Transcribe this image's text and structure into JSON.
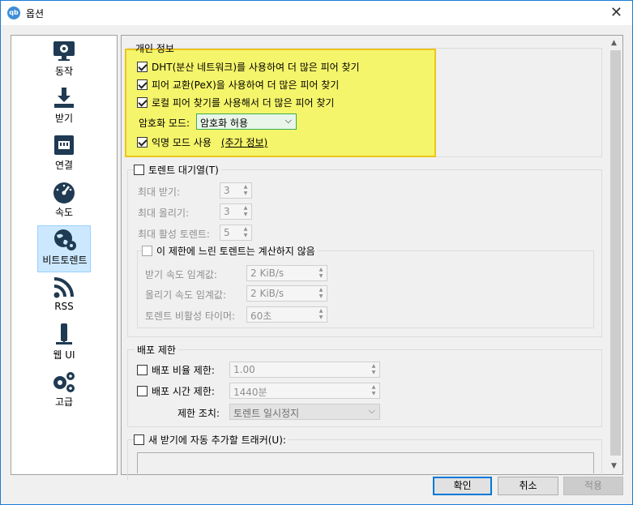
{
  "window": {
    "title": "옵션",
    "app_icon": "qb"
  },
  "sidebar": {
    "items": [
      {
        "label": "동작",
        "icon": "monitor-gear-icon"
      },
      {
        "label": "받기",
        "icon": "download-icon"
      },
      {
        "label": "연결",
        "icon": "network-port-icon"
      },
      {
        "label": "속도",
        "icon": "speedometer-icon"
      },
      {
        "label": "비트토렌트",
        "icon": "globe-gear-icon",
        "selected": true
      },
      {
        "label": "RSS",
        "icon": "rss-icon"
      },
      {
        "label": "웹 UI",
        "icon": "web-ui-icon"
      },
      {
        "label": "고급",
        "icon": "gears-icon"
      }
    ]
  },
  "privacy": {
    "title": "개인 정보",
    "dht": "DHT(분산 네트워크)를 사용하여 더 많은 피어 찾기",
    "pex": "피어 교환(PeX)을 사용하여 더 많은 피어 찾기",
    "lsd": "로컬 피어 찾기를 사용해서 더 많은 피어 찾기",
    "encryption_label": "암호화 모드:",
    "encryption_value": "암호화 허용",
    "anon_label": "익명 모드 사용",
    "anon_link": "(추가 정보)"
  },
  "queue": {
    "title": "토렌트 대기열(T)",
    "max_downloads_label": "최대 받기:",
    "max_downloads": "3",
    "max_uploads_label": "최대 올리기:",
    "max_uploads": "3",
    "max_active_label": "최대 활성 토렌트:",
    "max_active": "5",
    "slow_title": "이 제한에 느린 토렌트는 계산하지 않음",
    "dl_threshold_label": "받기 속도 임계값:",
    "dl_threshold": "2 KiB/s",
    "ul_threshold_label": "올리기 속도 임계값:",
    "ul_threshold": "2 KiB/s",
    "inactivity_label": "토렌트 비활성 타이머:",
    "inactivity": "60초"
  },
  "seeding": {
    "title": "배포 제한",
    "ratio_label": "배포 비율 제한:",
    "ratio": "1.00",
    "time_label": "배포 시간 제한:",
    "time": "1440분",
    "action_label": "제한 조치:",
    "action": "토렌트 일시정지"
  },
  "trackers": {
    "title": "새 받기에 자동 추가할 트래커(U):"
  },
  "buttons": {
    "ok": "확인",
    "cancel": "취소",
    "apply": "적용"
  },
  "colors": {
    "highlight": "#f5f56b",
    "highlight_border": "#ecc51a",
    "selection": "#cce8ff",
    "focus": "#0078d7"
  }
}
